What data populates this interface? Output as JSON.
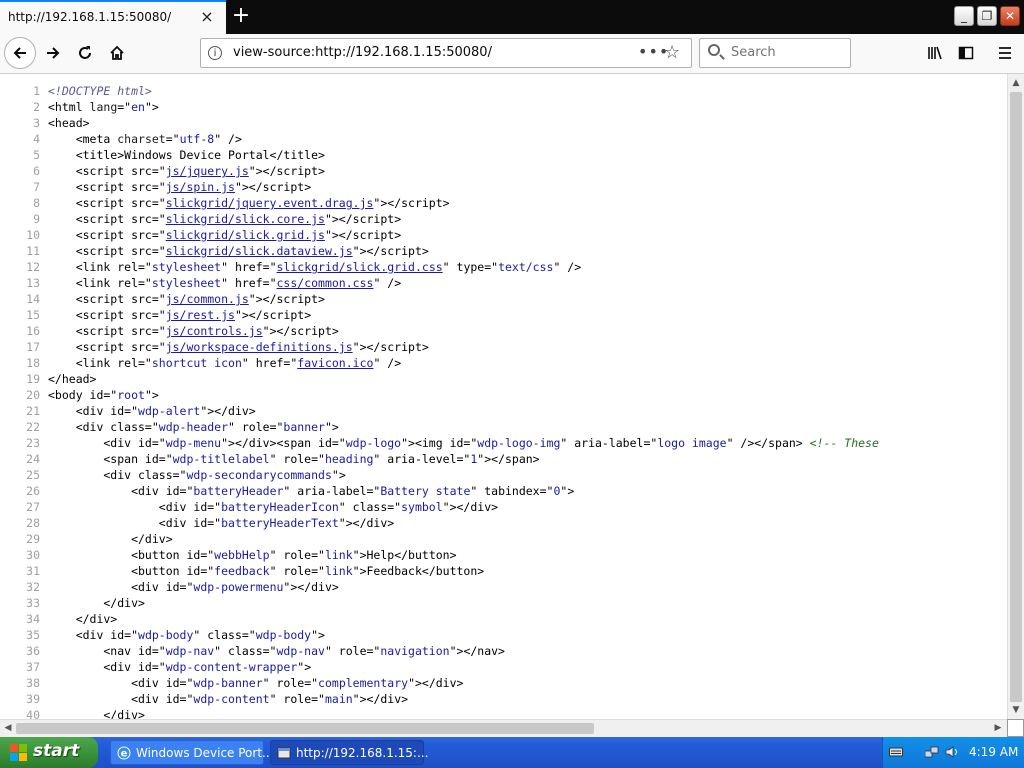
{
  "browser": {
    "tab_title": "http://192.168.1.15:50080/",
    "tab_close": "×",
    "new_tab": "+",
    "url": "view-source:http://192.168.1.15:50080/",
    "page_actions": "•••",
    "search_placeholder": "Search",
    "window_controls": {
      "minimize": "_",
      "restore": "❐",
      "close": "✕"
    }
  },
  "source_lines": [
    {
      "n": "1",
      "html": "<span class=\"doc\">&lt;!DOCTYPE html&gt;</span>"
    },
    {
      "n": "2",
      "html": "&lt;html <span class=\"attr\">lang</span>=\"<span class=\"val\">en</span>\"&gt;"
    },
    {
      "n": "3",
      "html": "&lt;head&gt;"
    },
    {
      "n": "4",
      "html": "    &lt;meta <span class=\"attr\">charset</span>=\"<span class=\"val\">utf-8</span>\" /&gt;"
    },
    {
      "n": "5",
      "html": "    &lt;title&gt;Windows Device Portal&lt;/title&gt;"
    },
    {
      "n": "6",
      "html": "    &lt;script src=\"<span class=\"lnk\">js/jquery.js</span>\"&gt;&lt;/script&gt;"
    },
    {
      "n": "7",
      "html": "    &lt;script src=\"<span class=\"lnk\">js/spin.js</span>\"&gt;&lt;/script&gt;"
    },
    {
      "n": "8",
      "html": "    &lt;script src=\"<span class=\"lnk\">slickgrid/jquery.event.drag.js</span>\"&gt;&lt;/script&gt;"
    },
    {
      "n": "9",
      "html": "    &lt;script src=\"<span class=\"lnk\">slickgrid/slick.core.js</span>\"&gt;&lt;/script&gt;"
    },
    {
      "n": "10",
      "html": "    &lt;script src=\"<span class=\"lnk\">slickgrid/slick.grid.js</span>\"&gt;&lt;/script&gt;"
    },
    {
      "n": "11",
      "html": "    &lt;script src=\"<span class=\"lnk\">slickgrid/slick.dataview.js</span>\"&gt;&lt;/script&gt;"
    },
    {
      "n": "12",
      "html": "    &lt;link rel=\"<span class=\"val\">stylesheet</span>\" href=\"<span class=\"lnk\">slickgrid/slick.grid.css</span>\" type=\"<span class=\"val\">text/css</span>\" /&gt;"
    },
    {
      "n": "13",
      "html": "    &lt;link rel=\"<span class=\"val\">stylesheet</span>\" href=\"<span class=\"lnk\">css/common.css</span>\" /&gt;"
    },
    {
      "n": "14",
      "html": "    &lt;script src=\"<span class=\"lnk\">js/common.js</span>\"&gt;&lt;/script&gt;"
    },
    {
      "n": "15",
      "html": "    &lt;script src=\"<span class=\"lnk\">js/rest.js</span>\"&gt;&lt;/script&gt;"
    },
    {
      "n": "16",
      "html": "    &lt;script src=\"<span class=\"lnk\">js/controls.js</span>\"&gt;&lt;/script&gt;"
    },
    {
      "n": "17",
      "html": "    &lt;script src=\"<span class=\"lnk\">js/workspace-definitions.js</span>\"&gt;&lt;/script&gt;"
    },
    {
      "n": "18",
      "html": "    &lt;link rel=\"<span class=\"val\">shortcut icon</span>\" href=\"<span class=\"lnk\">favicon.ico</span>\" /&gt;"
    },
    {
      "n": "19",
      "html": "&lt;/head&gt;"
    },
    {
      "n": "20",
      "html": "&lt;body id=\"<span class=\"val\">root</span>\"&gt;"
    },
    {
      "n": "21",
      "html": "    &lt;div id=\"<span class=\"val\">wdp-alert</span>\"&gt;&lt;/div&gt;"
    },
    {
      "n": "22",
      "html": "    &lt;div class=\"<span class=\"val\">wdp-header</span>\" role=\"<span class=\"val\">banner</span>\"&gt;"
    },
    {
      "n": "23",
      "html": "        &lt;div id=\"<span class=\"val\">wdp-menu</span>\"&gt;&lt;/div&gt;&lt;span id=\"<span class=\"val\">wdp-logo</span>\"&gt;&lt;img id=\"<span class=\"val\">wdp-logo-img</span>\" aria-label=\"<span class=\"val\">logo image</span>\" /&gt;&lt;/span&gt; <span class=\"cmt\">&lt;!-- These</span>"
    },
    {
      "n": "24",
      "html": "        &lt;span id=\"<span class=\"val\">wdp-titlelabel</span>\" role=\"<span class=\"val\">heading</span>\" aria-level=\"<span class=\"val\">1</span>\"&gt;&lt;/span&gt;"
    },
    {
      "n": "25",
      "html": "        &lt;div class=\"<span class=\"val\">wdp-secondarycommands</span>\"&gt;"
    },
    {
      "n": "26",
      "html": "            &lt;div id=\"<span class=\"val\">batteryHeader</span>\" aria-label=\"<span class=\"val\">Battery state</span>\" tabindex=\"<span class=\"val\">0</span>\"&gt;"
    },
    {
      "n": "27",
      "html": "                &lt;div id=\"<span class=\"val\">batteryHeaderIcon</span>\" class=\"<span class=\"val\">symbol</span>\"&gt;&lt;/div&gt;"
    },
    {
      "n": "28",
      "html": "                &lt;div id=\"<span class=\"val\">batteryHeaderText</span>\"&gt;&lt;/div&gt;"
    },
    {
      "n": "29",
      "html": "            &lt;/div&gt;"
    },
    {
      "n": "30",
      "html": "            &lt;button id=\"<span class=\"val\">webbHelp</span>\" role=\"<span class=\"val\">link</span>\"&gt;Help&lt;/button&gt;"
    },
    {
      "n": "31",
      "html": "            &lt;button id=\"<span class=\"val\">feedback</span>\" role=\"<span class=\"val\">link</span>\"&gt;Feedback&lt;/button&gt;"
    },
    {
      "n": "32",
      "html": "            &lt;div id=\"<span class=\"val\">wdp-powermenu</span>\"&gt;&lt;/div&gt;"
    },
    {
      "n": "33",
      "html": "        &lt;/div&gt;"
    },
    {
      "n": "34",
      "html": "    &lt;/div&gt;"
    },
    {
      "n": "35",
      "html": "    &lt;div id=\"<span class=\"val\">wdp-body</span>\" class=\"<span class=\"val\">wdp-body</span>\"&gt;"
    },
    {
      "n": "36",
      "html": "        &lt;nav id=\"<span class=\"val\">wdp-nav</span>\" class=\"<span class=\"val\">wdp-nav</span>\" role=\"<span class=\"val\">navigation</span>\"&gt;&lt;/nav&gt;"
    },
    {
      "n": "37",
      "html": "        &lt;div id=\"<span class=\"val\">wdp-content-wrapper</span>\"&gt;"
    },
    {
      "n": "38",
      "html": "            &lt;div id=\"<span class=\"val\">wdp-banner</span>\" role=\"<span class=\"val\">complementary</span>\"&gt;&lt;/div&gt;"
    },
    {
      "n": "39",
      "html": "            &lt;div id=\"<span class=\"val\">wdp-content</span>\" role=\"<span class=\"val\">main</span>\"&gt;&lt;/div&gt;"
    },
    {
      "n": "40",
      "html": "        &lt;/div&gt;"
    }
  ],
  "taskbar": {
    "start_label": "start",
    "tasks": [
      {
        "label": "Windows Device Port...",
        "active": false
      },
      {
        "label": "http://192.168.1.15:...",
        "active": true
      }
    ],
    "clock": "4:19 AM"
  }
}
